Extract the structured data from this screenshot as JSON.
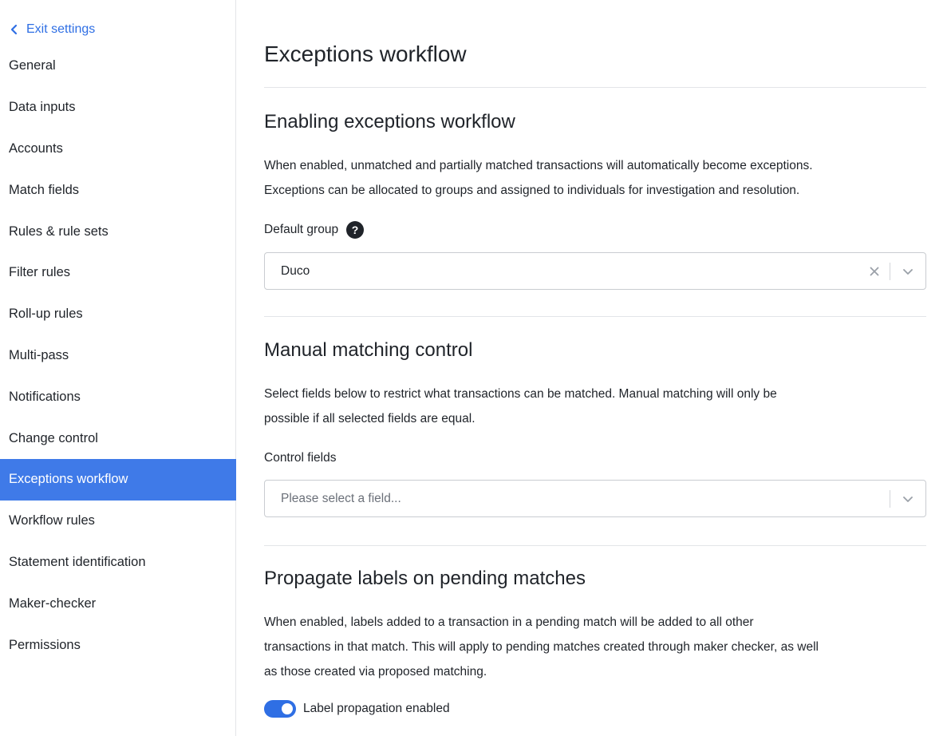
{
  "sidebar": {
    "exit_label": "Exit settings",
    "items": [
      {
        "label": "General"
      },
      {
        "label": "Data inputs"
      },
      {
        "label": "Accounts"
      },
      {
        "label": "Match fields"
      },
      {
        "label": "Rules & rule sets"
      },
      {
        "label": "Filter rules"
      },
      {
        "label": "Roll-up rules"
      },
      {
        "label": "Multi-pass"
      },
      {
        "label": "Notifications"
      },
      {
        "label": "Change control"
      },
      {
        "label": "Exceptions workflow"
      },
      {
        "label": "Workflow rules"
      },
      {
        "label": "Statement identification"
      },
      {
        "label": "Maker-checker"
      },
      {
        "label": "Permissions"
      }
    ],
    "active_item": "Exceptions workflow"
  },
  "main": {
    "page_title": "Exceptions workflow",
    "enabling": {
      "title": "Enabling exceptions workflow",
      "description_line1": "When enabled, unmatched and partially matched transactions will automatically become exceptions.",
      "description_line2": "Exceptions can be allocated to groups and assigned to individuals for investigation and resolution.",
      "default_group_label": "Default group",
      "default_group_value": "Duco"
    },
    "manual": {
      "title": "Manual matching control",
      "description_line1": "Select fields below to restrict what transactions can be matched. Manual matching will only be",
      "description_line2": "possible if all selected fields are equal.",
      "control_fields_label": "Control fields",
      "control_fields_placeholder": "Please select a field..."
    },
    "propagate": {
      "title": "Propagate labels on pending matches",
      "description_line1": "When enabled, labels added to a transaction in a pending match will be added to all other",
      "description_line2": "transactions in that match. This will apply to pending matches created through maker checker, as well",
      "description_line3": "as those created via proposed matching.",
      "toggle_label": "Label propagation enabled",
      "toggle_on": true
    }
  },
  "colors": {
    "accent": "#2f6fe4",
    "active_nav_bg": "#3f7ae8"
  }
}
